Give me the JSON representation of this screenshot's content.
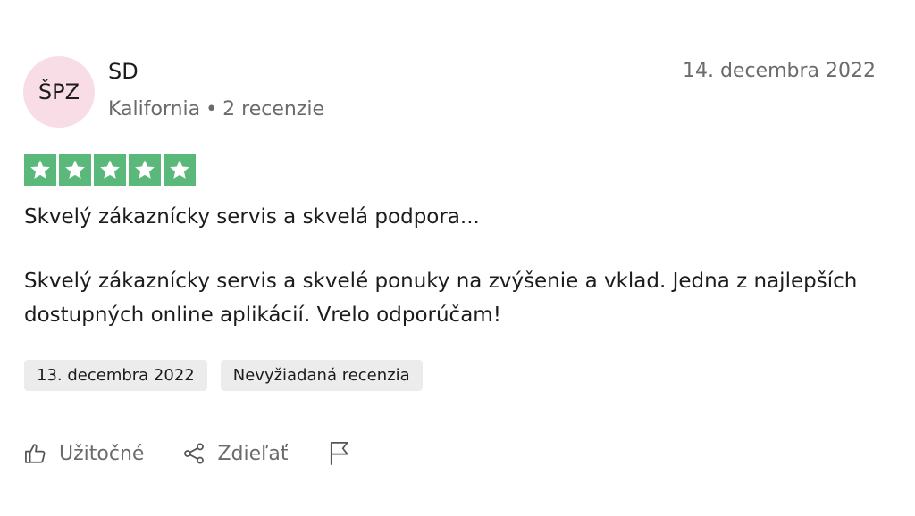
{
  "reviewer": {
    "initials": "ŠPZ",
    "name": "SD",
    "location": "Kalifornia",
    "separator": "•",
    "review_count": "2 recenzie",
    "avatar_color": "#f9dde6"
  },
  "review_date": "14. decembra 2022",
  "rating": {
    "stars": 5,
    "max": 5,
    "star_color": "#59b87a"
  },
  "review": {
    "title": "Skvelý zákaznícky servis a skvelá podpora...",
    "text": "Skvelý zákaznícky servis a skvelé ponuky na zvýšenie a vklad. Jedna z najlepších dostupných online aplikácií. Vrelo odporúčam!"
  },
  "tags": {
    "experience_date": "13. decembra 2022",
    "unsolicited": "Nevyžiadaná recenzia"
  },
  "actions": {
    "useful_label": "Užitočné",
    "useful_icon": "thumbs-up-icon",
    "share_label": "Zdieľať",
    "share_icon": "share-icon",
    "report_icon": "flag-icon"
  }
}
